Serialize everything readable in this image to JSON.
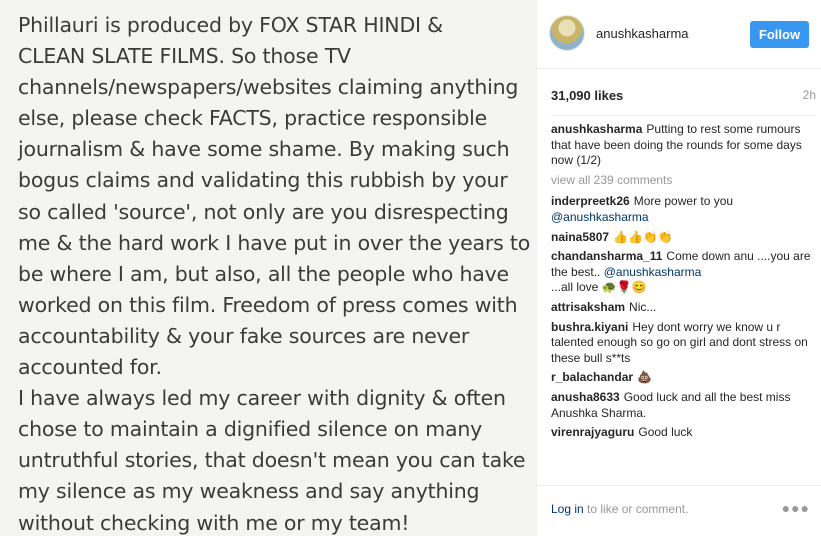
{
  "photo": {
    "lines": [
      "Phillauri is produced by FOX STAR HINDI &",
      "CLEAN SLATE FILMS. So those TV",
      "channels/newspapers/websites claiming anything",
      "else, please check FACTS, practice responsible",
      "journalism & have some shame. By making such",
      "bogus claims and validating this rubbish by your",
      "so called 'source', not only are you disrespecting",
      "me & the hard work I have put in over the years to",
      "be where I am, but also, all the people who have",
      "worked on this film. Freedom of press comes with",
      "accountability & your fake sources are never",
      "accounted for.",
      "I have always led my career with dignity & often",
      "chose to maintain a dignified silence on many",
      "untruthful stories, that doesn't mean you can take",
      "my silence as my weakness and say anything",
      "without checking with me or my team!"
    ]
  },
  "header": {
    "username": "anushkasharma",
    "follow_label": "Follow"
  },
  "post": {
    "likes": "31,090 likes",
    "time": "2h"
  },
  "caption": {
    "user": "anushkasharma",
    "text": "Putting to rest some rumours that have been doing the rounds for some days now (1/2)"
  },
  "view_all": "view all 239 comments",
  "comments": [
    {
      "user": "inderpreetk26",
      "text": "More power to you",
      "mention": "@anushkasharma",
      "after": ""
    },
    {
      "user": "naina5807",
      "text": "👍👍👏👏",
      "mention": "",
      "after": ""
    },
    {
      "user": "chandansharma_11",
      "text": "Come down anu ....you are the best..",
      "mention": "@anushkasharma",
      "after": "...all love 🐢🌹😊"
    },
    {
      "user": "attrisaksham",
      "text": "Nic...",
      "mention": "",
      "after": ""
    },
    {
      "user": "bushra.kiyani",
      "text": "Hey dont worry we know u r talented enough so go on girl and dont stress on these bull s**ts",
      "mention": "",
      "after": ""
    },
    {
      "user": "r_balachandar",
      "text": "💩",
      "mention": "",
      "after": ""
    },
    {
      "user": "anusha8633",
      "text": "Good luck and all the best miss Anushka Sharma.",
      "mention": "",
      "after": ""
    },
    {
      "user": "virenrajyaguru",
      "text": "Good luck",
      "mention": "",
      "after": ""
    }
  ],
  "footer": {
    "login_link": "Log in",
    "login_rest": " to like or comment.",
    "more_icon": "more-options-icon"
  }
}
